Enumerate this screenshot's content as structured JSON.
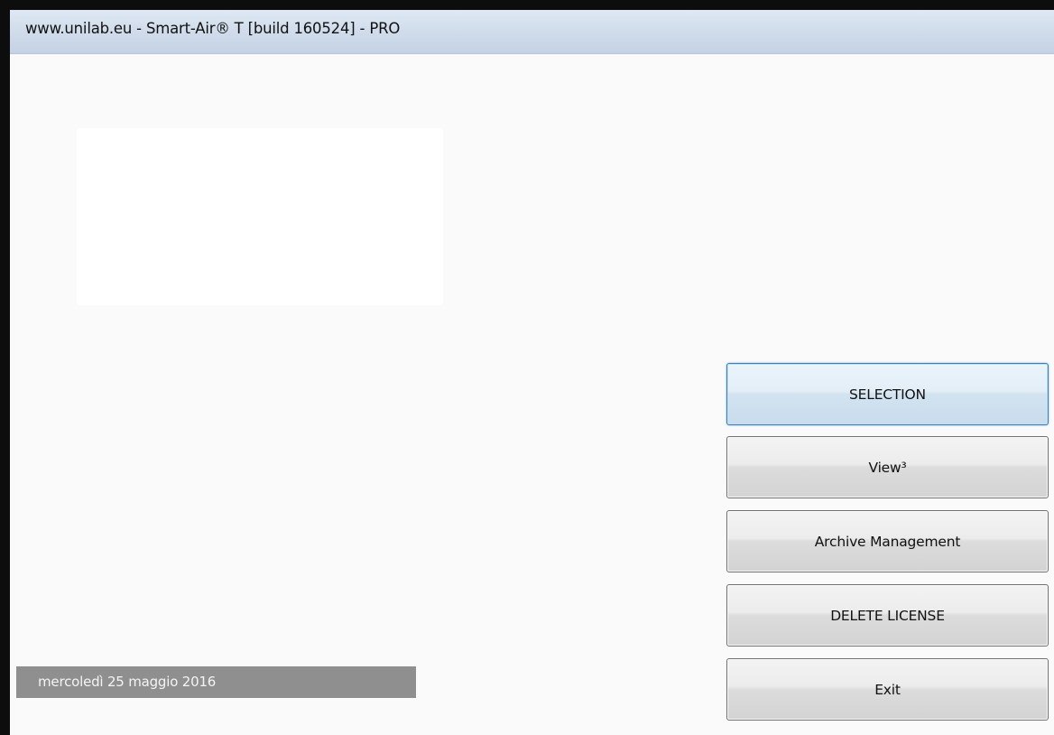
{
  "window": {
    "title": "www.unilab.eu - Smart-Air® T [build 160524] - PRO"
  },
  "buttons": [
    {
      "label": "SELECTION",
      "focused": true
    },
    {
      "label": "View³",
      "focused": false
    },
    {
      "label": "Archive Management",
      "focused": false
    },
    {
      "label": "DELETE LICENSE",
      "focused": false
    },
    {
      "label": "Exit",
      "focused": false
    }
  ],
  "status": {
    "date": "mercoledì 25 maggio 2016"
  },
  "colors": {
    "title_bar": "#cfdbea",
    "background": "#fafafa",
    "date_bar": "#8f8f8f",
    "focus_border": "#3c7fb1"
  }
}
